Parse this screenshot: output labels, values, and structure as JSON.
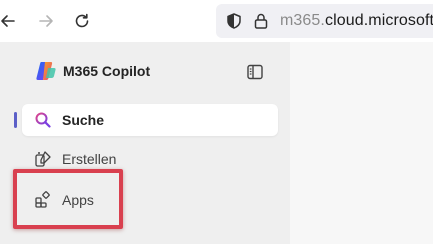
{
  "browser": {
    "back_icon": "arrow-left-icon",
    "forward_icon": "arrow-right-icon",
    "reload_icon": "reload-icon",
    "url_host_dim": "m365.",
    "url_host_main": "cloud.microsoft/"
  },
  "app": {
    "title": "M365 Copilot",
    "accent": "#5b5fc7"
  },
  "sidebar": {
    "items": [
      {
        "label": "Suche",
        "icon": "search-icon",
        "active": true
      },
      {
        "label": "Erstellen",
        "icon": "create-icon",
        "active": false
      },
      {
        "label": "Apps",
        "icon": "apps-icon",
        "active": false
      }
    ]
  },
  "annotation": {
    "color": "#d9404f"
  }
}
